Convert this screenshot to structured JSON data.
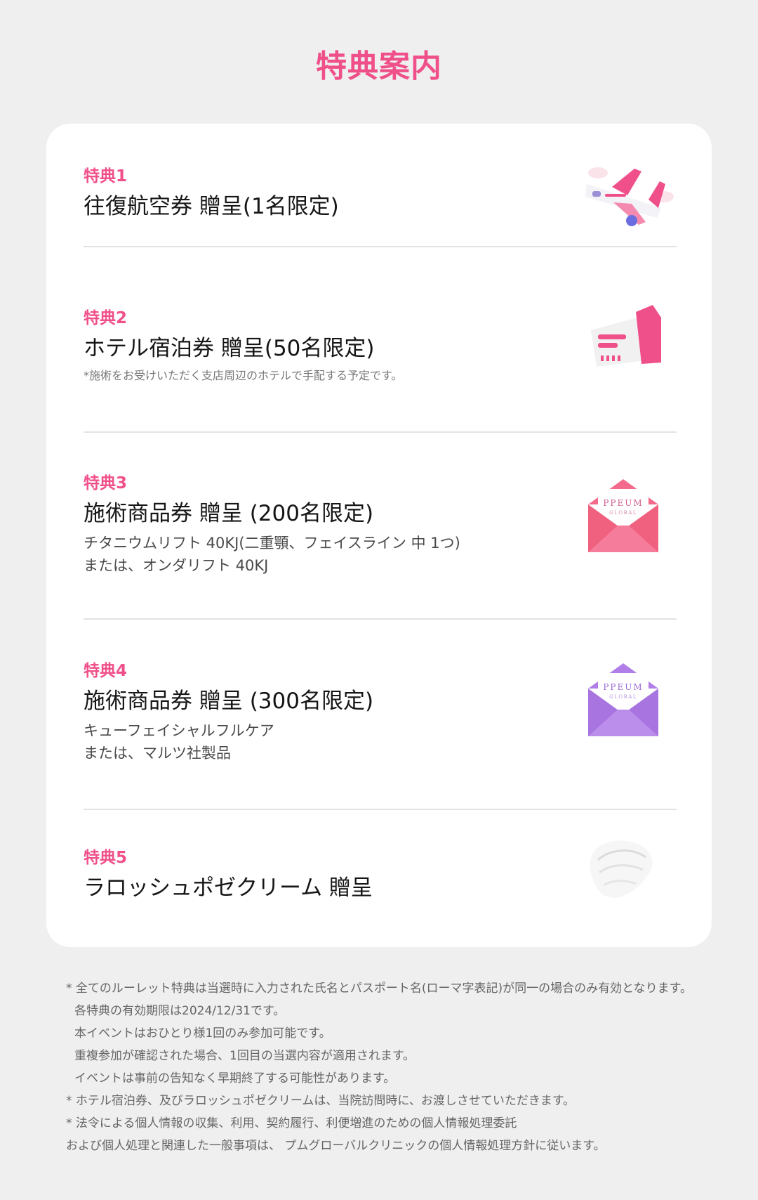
{
  "title": "特典案内",
  "items": [
    {
      "tag": "特典1",
      "title": "往復航空券 贈呈(1名限定)",
      "icon": "airplane-icon"
    },
    {
      "tag": "特典2",
      "title": "ホテル宿泊券 贈呈(50名限定)",
      "note": "*施術をお受けいただく支店周辺のホテルで手配する予定です。",
      "icon": "ticket-icon"
    },
    {
      "tag": "特典3",
      "title": "施術商品券 贈呈 (200名限定)",
      "desc1": "チタニウムリフト 40KJ(二重顎、フェイスライン 中 1つ)",
      "desc2": "または、オンダリフト 40KJ",
      "icon": "pink-envelope-icon",
      "envelope_text": "PPEUM",
      "envelope_sub": "GLOBAL"
    },
    {
      "tag": "特典4",
      "title": "施術商品券 贈呈 (300名限定)",
      "desc1": "キューフェイシャルフルケア",
      "desc2": "または、マルツ社製品",
      "icon": "purple-envelope-icon",
      "envelope_text": "PPEUM",
      "envelope_sub": "GLOBAL"
    },
    {
      "tag": "特典5",
      "title": "ラロッシュポゼクリーム 贈呈",
      "icon": "cream-icon"
    }
  ],
  "notes": [
    "* 全てのルーレット特典は当選時に入力された氏名とパスポート名(ローマ字表記)が同一の場合のみ有効となります。",
    "各特典の有効期限は2024/12/31です。",
    "本イベントはおひとり様1回のみ参加可能です。",
    "重複参加が確認された場合、1回目の当選内容が適用されます。",
    "イベントは事前の告知なく早期終了する可能性があります。",
    "* ホテル宿泊券、及びラロッシュポゼクリームは、当院訪問時に、お渡しさせていただきます。",
    "* 法令による個人情報の収集、利用、契約履行、利便増進のための個人情報処理委託",
    "および個人処理と関連した一般事項は、 プムグローバルクリニックの個人情報処理方針に従います。"
  ],
  "colors": {
    "accent": "#f0508a",
    "envelope_pink": "#f36a8c",
    "envelope_purple": "#b07ee6"
  }
}
